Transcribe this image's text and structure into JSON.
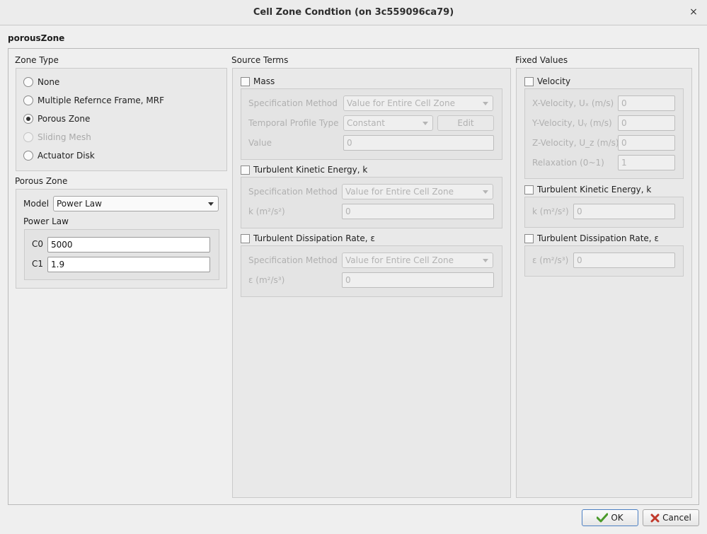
{
  "window": {
    "title": "Cell Zone Condtion (on 3c559096ca79)",
    "close_glyph": "×"
  },
  "zone_name": "porousZone",
  "zone_type": {
    "title": "Zone Type",
    "options": [
      {
        "label": "None",
        "checked": false,
        "disabled": false
      },
      {
        "label": "Multiple Refernce Frame, MRF",
        "checked": false,
        "disabled": false
      },
      {
        "label": "Porous Zone",
        "checked": true,
        "disabled": false
      },
      {
        "label": "Sliding Mesh",
        "checked": false,
        "disabled": true
      },
      {
        "label": "Actuator Disk",
        "checked": false,
        "disabled": false
      }
    ]
  },
  "porous_zone": {
    "title": "Porous Zone",
    "model_label": "Model",
    "model_value": "Power Law",
    "power_law_title": "Power Law",
    "c0_label": "C0",
    "c0_value": "5000",
    "c1_label": "C1",
    "c1_value": "1.9"
  },
  "source_terms": {
    "title": "Source Terms",
    "mass": {
      "label": "Mass",
      "spec_label": "Specification Method",
      "spec_value": "Value for Entire Cell Zone",
      "temporal_label": "Temporal Profile Type",
      "temporal_value": "Constant",
      "edit_label": "Edit",
      "value_label": "Value",
      "value": "0"
    },
    "tke": {
      "label": "Turbulent Kinetic Energy, k",
      "spec_label": "Specification Method",
      "spec_value": "Value for Entire Cell Zone",
      "k_label": "k (m²/s²)",
      "k_value": "0"
    },
    "tdr": {
      "label": "Turbulent Dissipation Rate, ε",
      "spec_label": "Specification Method",
      "spec_value": "Value for Entire Cell Zone",
      "e_label": "ε (m²/s³)",
      "e_value": "0"
    }
  },
  "fixed_values": {
    "title": "Fixed Values",
    "velocity": {
      "label": "Velocity",
      "ux_label": "X-Velocity, Uₓ (m/s)",
      "ux": "0",
      "uy_label": "Y-Velocity, Uᵧ (m/s)",
      "uy": "0",
      "uz_label": "Z-Velocity, U_z (m/s)",
      "uz": "0",
      "relax_label": "Relaxation (0~1)",
      "relax": "1"
    },
    "tke": {
      "label": "Turbulent Kinetic Energy, k",
      "k_label": "k (m²/s²)",
      "k_value": "0"
    },
    "tdr": {
      "label": "Turbulent Dissipation Rate, ε",
      "e_label": "ε (m²/s³)",
      "e_value": "0"
    }
  },
  "buttons": {
    "ok": "OK",
    "cancel": "Cancel"
  },
  "colors": {
    "ok_icon": "#4a9a2a",
    "cancel_icon": "#c0392b",
    "accent": "#4c7fc3"
  }
}
